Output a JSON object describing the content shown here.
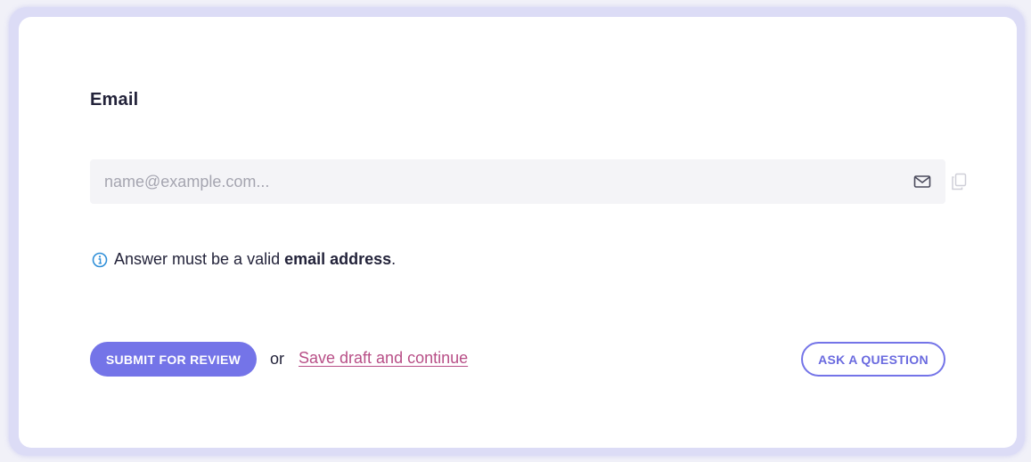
{
  "question": {
    "label": "Email",
    "input": {
      "placeholder": "name@example.com...",
      "value": ""
    },
    "hint": {
      "prefix": "Answer must be a valid",
      "emphasis": "email address",
      "suffix": "."
    }
  },
  "actions": {
    "submit_label": "SUBMIT FOR REVIEW",
    "or_text": "or",
    "save_link_label": "Save draft and continue",
    "ask_label": "ASK A QUESTION"
  },
  "icons": {
    "input_icon": "mail-icon",
    "copy_icon": "copy-icon",
    "hint_icon": "info-icon"
  },
  "colors": {
    "accent": "#7474e8",
    "link": "#b84f87",
    "info": "#2f8fd8"
  }
}
